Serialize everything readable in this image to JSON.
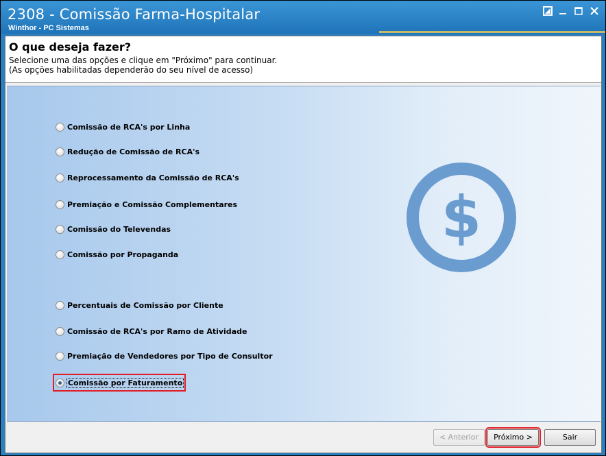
{
  "window": {
    "title": "2308 - Comissão Farma-Hospitalar",
    "subtitle": "Winthor - PC Sistemas"
  },
  "header": {
    "title": "O que deseja fazer?",
    "line1": "Selecione uma das opções e clique em \"Próximo\" para continuar.",
    "line2": "(As opções habilitadas dependerão do seu nível de acesso)"
  },
  "options": [
    {
      "label": "Comissão de RCA's por Linha",
      "checked": false
    },
    {
      "label": "Redução de Comissão de RCA's",
      "checked": false
    },
    {
      "label": "Reprocessamento da Comissão de RCA's",
      "checked": false
    },
    {
      "label": "Premiação e Comissão Complementares",
      "checked": false
    },
    {
      "label": "Comissão do Televendas",
      "checked": false
    },
    {
      "label": "Comissão por Propaganda",
      "checked": false
    },
    {
      "label": "Percentuais de Comissão por Cliente",
      "checked": false
    },
    {
      "label": "Comissão de RCA's por Ramo de Atividade",
      "checked": false
    },
    {
      "label": "Premiação de Vendedores por Tipo de Consultor",
      "checked": false
    },
    {
      "label": "Comissão por Faturamento",
      "checked": true
    }
  ],
  "buttons": {
    "back": "< Anterior",
    "next": "Próximo >",
    "exit": "Sair"
  },
  "colors": {
    "title_bar": "#2a7fc0",
    "coin": "#6a9ccf",
    "highlight": "#e31b23"
  },
  "icons": {
    "coin": "dollar-coin-icon"
  }
}
